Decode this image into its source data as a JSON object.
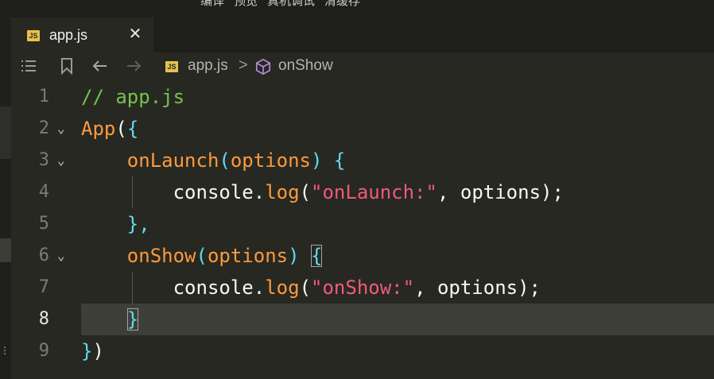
{
  "menu": {
    "items": [
      "编译",
      "预览",
      "真机调试",
      "清缓存"
    ]
  },
  "tab": {
    "badge": "JS",
    "label": "app.js",
    "close": "✕"
  },
  "breadcrumb": {
    "file_badge": "JS",
    "file": "app.js",
    "separator": ">",
    "symbol": "onShow"
  },
  "editor": {
    "active_line": 8,
    "lines": [
      {
        "num": "1",
        "fold": ""
      },
      {
        "num": "2",
        "fold": "⌄"
      },
      {
        "num": "3",
        "fold": "⌄"
      },
      {
        "num": "4",
        "fold": ""
      },
      {
        "num": "5",
        "fold": ""
      },
      {
        "num": "6",
        "fold": "⌄"
      },
      {
        "num": "7",
        "fold": ""
      },
      {
        "num": "8",
        "fold": ""
      },
      {
        "num": "9",
        "fold": ""
      }
    ],
    "tokens": {
      "l1": "// app.js",
      "l2_fn": "App",
      "l2_paren": "(",
      "l2_brace": "{",
      "l3_fn": "onLaunch",
      "l3_open": "(",
      "l3_param": "options",
      "l3_close": ")",
      "l3_brace": "{",
      "l4_obj": "console",
      "l4_dot": ".",
      "l4_method": "log",
      "l4_open": "(",
      "l4_str": "\"onLaunch:\"",
      "l4_rest": ", options);",
      "l5": "},",
      "l6_fn": "onShow",
      "l6_open": "(",
      "l6_param": "options",
      "l6_close": ")",
      "l6_brace": "{",
      "l7_obj": "console",
      "l7_dot": ".",
      "l7_method": "log",
      "l7_open": "(",
      "l7_str": "\"onShow:\"",
      "l7_rest": ", options);",
      "l8": "}",
      "l9_brace": "}",
      "l9_paren": ")"
    }
  },
  "colors": {
    "background": "#272822",
    "comment": "#75c24e",
    "function": "#fd9a3d",
    "brace": "#66d9ef",
    "string": "#f05a78",
    "js_badge": "#e7c24a"
  },
  "icons": [
    "list-icon",
    "bookmark-icon",
    "back-arrow-icon",
    "forward-arrow-icon",
    "cube-icon",
    "close-icon",
    "chevron-down-icon"
  ]
}
